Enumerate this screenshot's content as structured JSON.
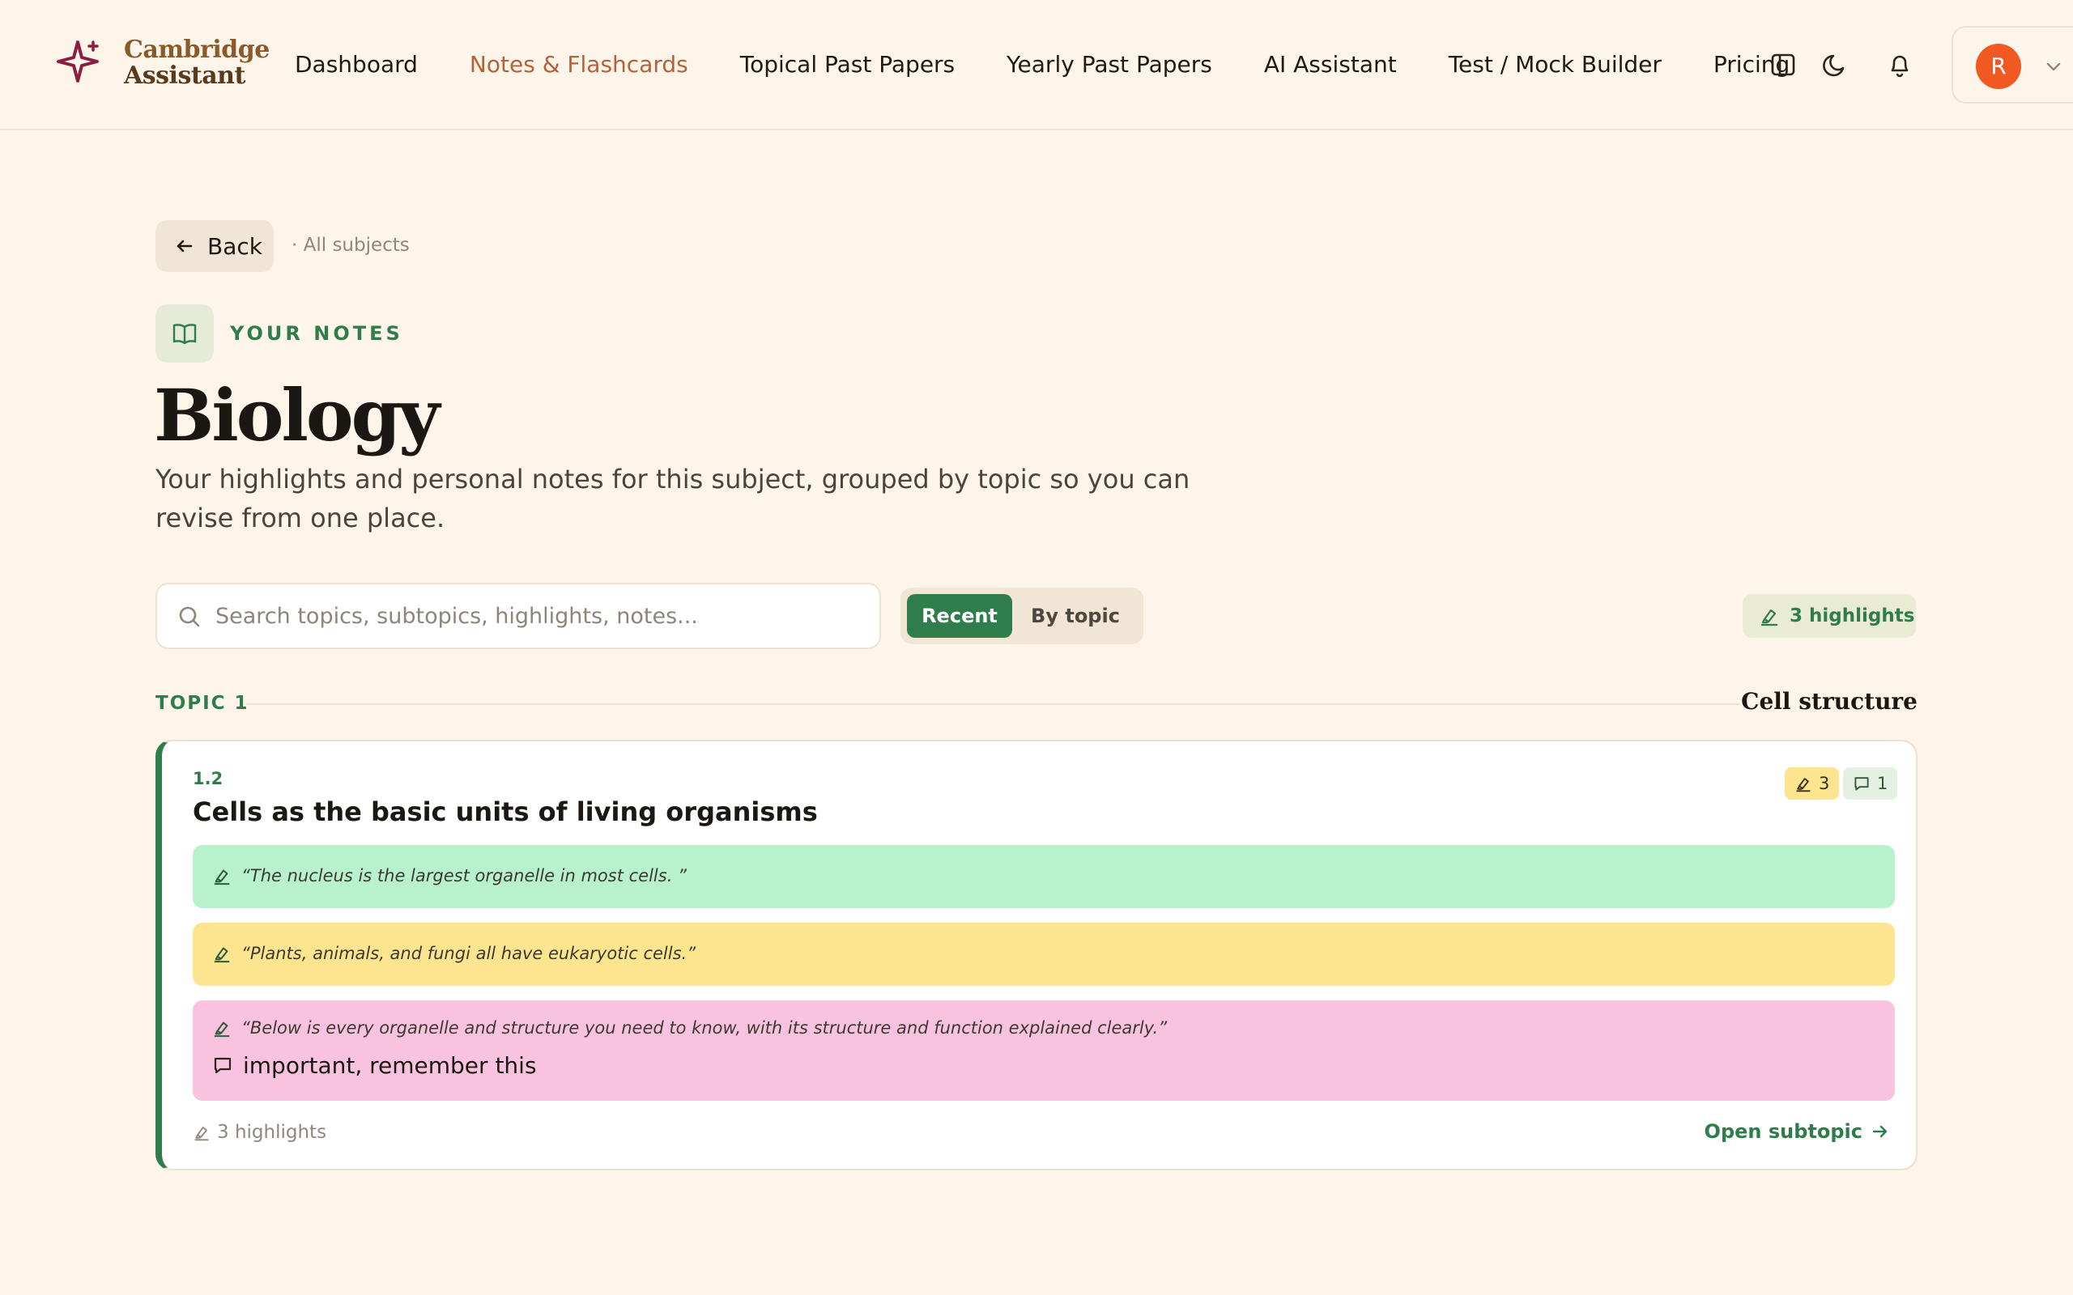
{
  "brand": {
    "line1": "Cambridge",
    "line2": "Assistant",
    "icon": "sparkle-icon",
    "color": "#8b1e3f"
  },
  "nav": {
    "items": [
      {
        "label": "Dashboard",
        "active": false
      },
      {
        "label": "Notes & Flashcards",
        "active": true
      },
      {
        "label": "Topical Past Papers",
        "active": false
      },
      {
        "label": "Yearly Past Papers",
        "active": false
      },
      {
        "label": "AI Assistant",
        "active": false
      },
      {
        "label": "Test / Mock Builder",
        "active": false
      },
      {
        "label": "Pricing",
        "active": false
      }
    ],
    "icons": [
      "sidebar-toggle-icon",
      "moon-icon",
      "bell-icon"
    ]
  },
  "user": {
    "initial": "R",
    "avatar_color": "#f05a22"
  },
  "back": {
    "label": "Back",
    "crumb": "· All subjects"
  },
  "page": {
    "kicker": "YOUR NOTES",
    "title": "Biology",
    "subtitle": "Your highlights and personal notes for this subject, grouped by topic so you can revise from one place."
  },
  "search": {
    "placeholder": "Search topics, subtopics, highlights, notes...",
    "value": ""
  },
  "view_toggle": {
    "recent": "Recent",
    "by_topic": "By topic",
    "selected": "Recent"
  },
  "highlight_count": "3 highlights",
  "topic": {
    "label": "TOPIC 1",
    "name": "Cell structure",
    "subtopic": {
      "number": "1.2",
      "title": "Cells as the basic units of living organisms",
      "highlight_badge": "3",
      "note_badge": "1",
      "highlights": [
        {
          "text": "“The nucleus is the largest organelle in most cells. ”",
          "color": "#b8f2cc"
        },
        {
          "text": "“Plants, animals, and fungi all have eukaryotic cells.”",
          "color": "#fde58f"
        },
        {
          "text": "“Below is every organelle and structure you need to know, with its structure and function explained clearly.”",
          "color": "#f9c3df",
          "note": "important, remember this"
        }
      ],
      "footer_count": "3 highlights",
      "open_label": "Open subtopic"
    }
  },
  "colors": {
    "accent_green": "#2f7d4a",
    "active_nav": "#b5613a",
    "background": "#fdf5e9"
  }
}
